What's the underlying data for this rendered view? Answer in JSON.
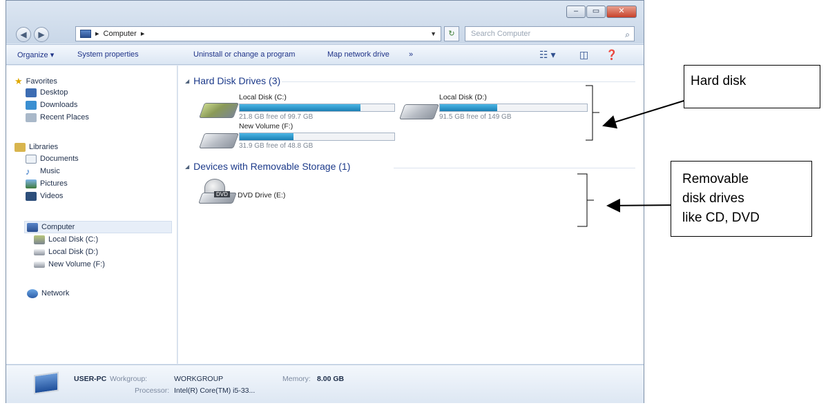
{
  "window": {
    "caption_buttons": [
      "minimize",
      "maximize",
      "close"
    ],
    "address": {
      "segments": [
        "Computer"
      ],
      "separator": "▸"
    },
    "search_placeholder": "Search Computer"
  },
  "toolbar": {
    "organize": "Organize ▾",
    "system_properties": "System properties",
    "uninstall": "Uninstall or change a program",
    "map_network": "Map network drive",
    "more": "»"
  },
  "sidebar": {
    "favorites": "Favorites",
    "desktop": "Desktop",
    "downloads": "Downloads",
    "recent_places": "Recent Places",
    "libraries": "Libraries",
    "documents": "Documents",
    "music": "Music",
    "pictures": "Pictures",
    "videos": "Videos",
    "computer": "Computer",
    "local_c": "Local Disk (C:)",
    "local_d": "Local Disk (D:)",
    "new_volume_f": "New Volume (F:)",
    "network": "Network"
  },
  "main": {
    "hdd_group": "Hard Disk Drives (3)",
    "removable_group": "Devices with Removable Storage (1)",
    "drives": [
      {
        "name": "Local Disk (C:)",
        "free": "21.8 GB free of 99.7 GB",
        "used_fraction": 0.78
      },
      {
        "name": "Local Disk (D:)",
        "free": "91.5 GB free of 149 GB",
        "used_fraction": 0.39
      },
      {
        "name": "New Volume (F:)",
        "free": "31.9 GB free of 48.8 GB",
        "used_fraction": 0.35
      }
    ],
    "dvd": {
      "name": "DVD Drive (E:)",
      "label": "DVD"
    }
  },
  "details": {
    "pc_name": "USER-PC",
    "workgroup_label": "Workgroup:",
    "workgroup": "WORKGROUP",
    "memory_label": "Memory:",
    "memory": "8.00 GB",
    "processor_label": "Processor:",
    "processor": "Intel(R) Core(TM) i5-33..."
  },
  "callouts": {
    "hard_disk": "Hard disk",
    "removable_line1": "Removable",
    "removable_line2": "disk drives",
    "removable_line3": "like CD, DVD"
  },
  "colors": {
    "link_blue": "#1c3a8a",
    "capacity_bar": "#1b7fb4",
    "close_red": "#c8412a"
  }
}
